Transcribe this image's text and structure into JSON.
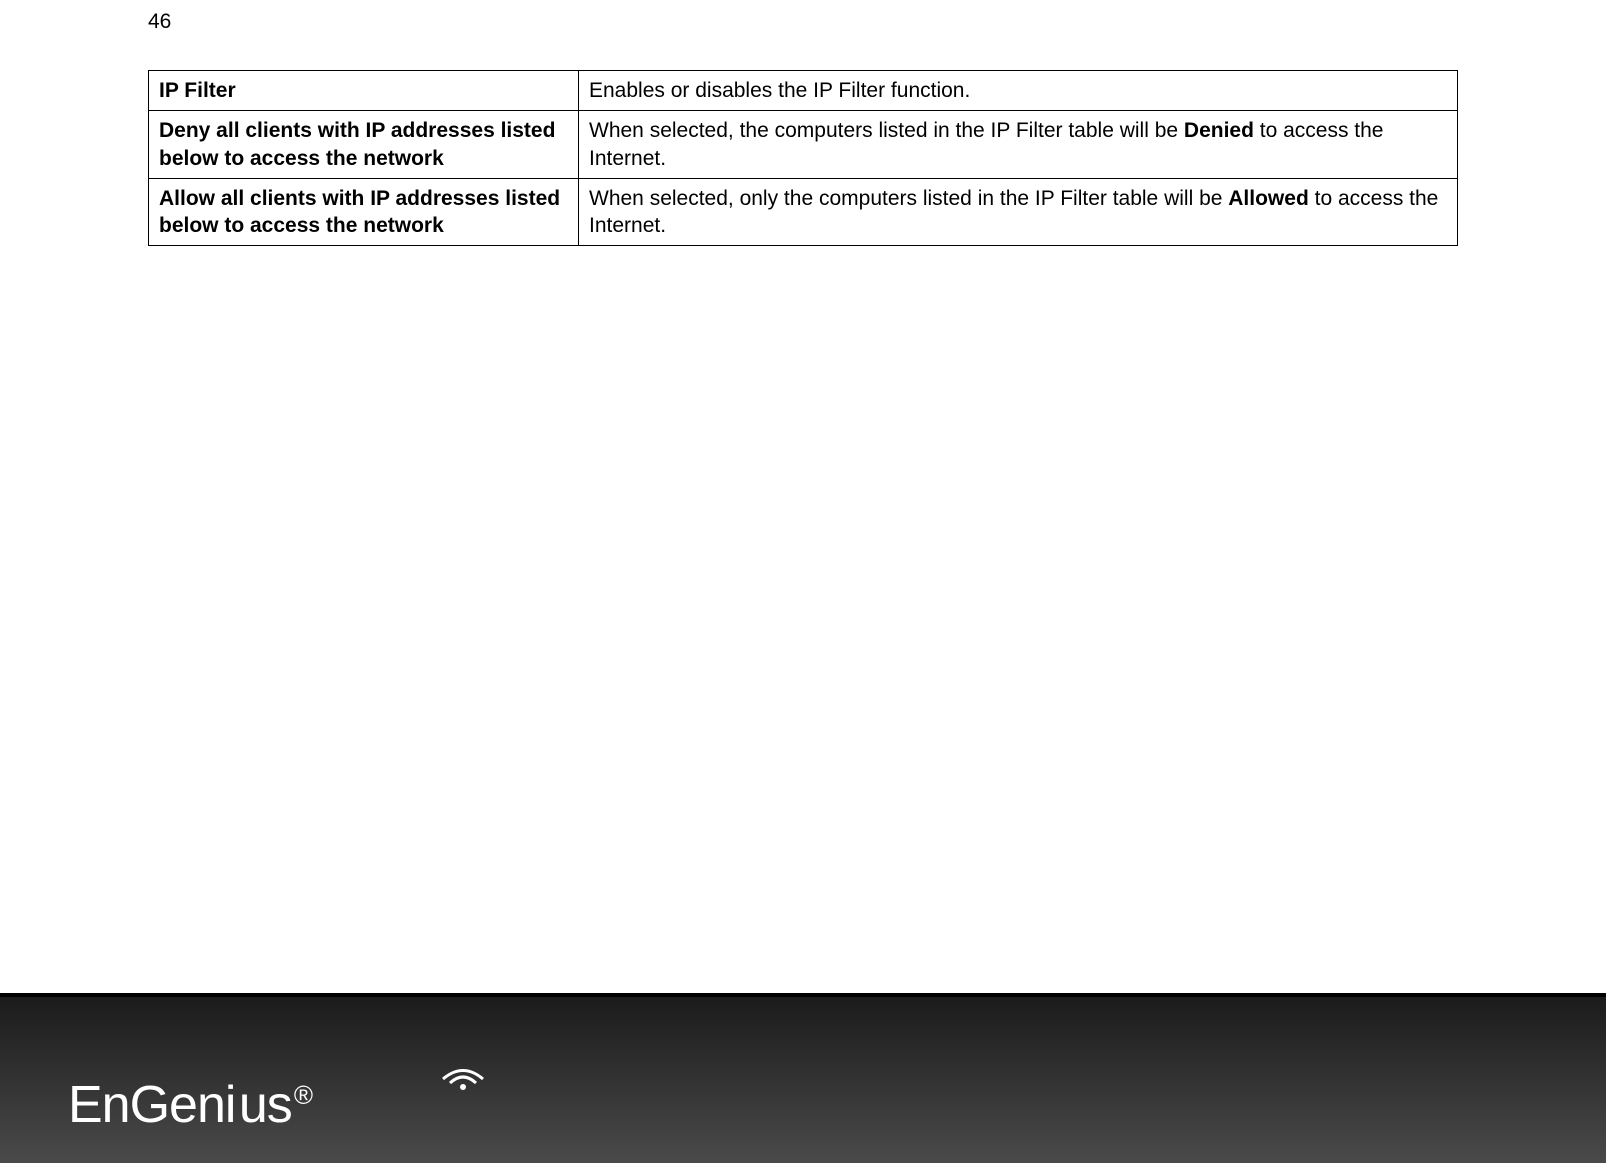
{
  "page_number": "46",
  "table": {
    "rows": [
      {
        "label": "IP Filter",
        "desc_parts": [
          {
            "text": "Enables or disables the IP Filter function.",
            "bold": false
          }
        ]
      },
      {
        "label": "Deny all clients with IP addresses listed below to access the network",
        "desc_parts": [
          {
            "text": "When selected, the computers listed in the IP Filter table will be ",
            "bold": false
          },
          {
            "text": "Denied",
            "bold": true
          },
          {
            "text": " to access the Internet.",
            "bold": false
          }
        ]
      },
      {
        "label": "Allow all clients with IP addresses listed below to access the network",
        "desc_parts": [
          {
            "text": "When selected, only the computers listed in the IP Filter table will be ",
            "bold": false
          },
          {
            "text": "Allowed",
            "bold": true
          },
          {
            "text": " to access the Internet.",
            "bold": false
          }
        ]
      }
    ]
  },
  "logo": {
    "text_part1": "EnGen",
    "text_part2": "us",
    "reg": "®"
  }
}
